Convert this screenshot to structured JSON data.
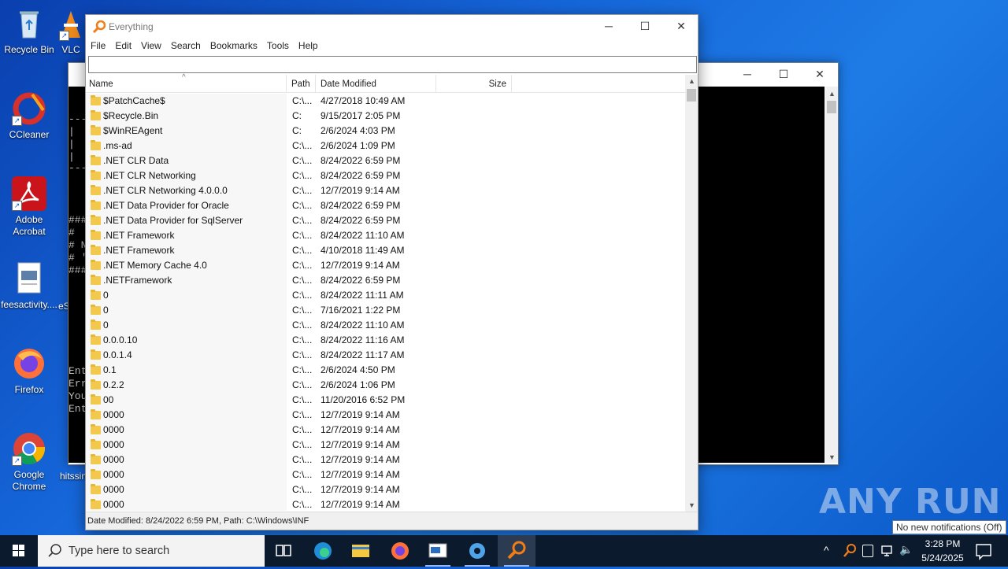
{
  "desktop_icons": [
    {
      "label": "Recycle Bin",
      "icon": "recycle-bin-icon"
    },
    {
      "label": "VLC",
      "icon": "vlc-icon"
    },
    {
      "label": "CCleaner",
      "icon": "ccleaner-icon"
    },
    {
      "label": "Adobe Acrobat",
      "icon": "acrobat-icon"
    },
    {
      "label": "feesactivity....",
      "icon": "image-file-icon"
    },
    {
      "label": "Firefox",
      "icon": "firefox-icon"
    },
    {
      "label": "Google Chrome",
      "icon": "chrome-icon"
    },
    {
      "label": "eSel",
      "icon": "partial-icon"
    },
    {
      "label": "hitssin",
      "icon": "partial-icon"
    }
  ],
  "console_window": {
    "lines": [
      "---",
      "|",
      "|",
      "|",
      "---",
      "###",
      "#",
      "# N",
      "# '",
      "###",
      "Ent",
      "Err",
      "You",
      "Ent"
    ]
  },
  "everything": {
    "title": "Everything",
    "menu": [
      "File",
      "Edit",
      "View",
      "Search",
      "Bookmarks",
      "Tools",
      "Help"
    ],
    "search_value": "",
    "columns": {
      "name": "Name",
      "path": "Path",
      "date": "Date Modified",
      "size": "Size"
    },
    "rows": [
      {
        "name": "$PatchCache$",
        "path": "C:\\...",
        "date": "4/27/2018 10:49 AM"
      },
      {
        "name": "$Recycle.Bin",
        "path": "C:",
        "date": "9/15/2017 2:05 PM"
      },
      {
        "name": "$WinREAgent",
        "path": "C:",
        "date": "2/6/2024 4:03 PM"
      },
      {
        "name": ".ms-ad",
        "path": "C:\\...",
        "date": "2/6/2024 1:09 PM"
      },
      {
        "name": ".NET CLR Data",
        "path": "C:\\...",
        "date": "8/24/2022 6:59 PM"
      },
      {
        "name": ".NET CLR Networking",
        "path": "C:\\...",
        "date": "8/24/2022 6:59 PM"
      },
      {
        "name": ".NET CLR Networking 4.0.0.0",
        "path": "C:\\...",
        "date": "12/7/2019 9:14 AM"
      },
      {
        "name": ".NET Data Provider for Oracle",
        "path": "C:\\...",
        "date": "8/24/2022 6:59 PM"
      },
      {
        "name": ".NET Data Provider for SqlServer",
        "path": "C:\\...",
        "date": "8/24/2022 6:59 PM"
      },
      {
        "name": ".NET Framework",
        "path": "C:\\...",
        "date": "8/24/2022 11:10 AM"
      },
      {
        "name": ".NET Framework",
        "path": "C:\\...",
        "date": "4/10/2018 11:49 AM"
      },
      {
        "name": ".NET Memory Cache 4.0",
        "path": "C:\\...",
        "date": "12/7/2019 9:14 AM"
      },
      {
        "name": ".NETFramework",
        "path": "C:\\...",
        "date": "8/24/2022 6:59 PM"
      },
      {
        "name": "0",
        "path": "C:\\...",
        "date": "8/24/2022 11:11 AM"
      },
      {
        "name": "0",
        "path": "C:\\...",
        "date": "7/16/2021 1:22 PM"
      },
      {
        "name": "0",
        "path": "C:\\...",
        "date": "8/24/2022 11:10 AM"
      },
      {
        "name": "0.0.0.10",
        "path": "C:\\...",
        "date": "8/24/2022 11:16 AM"
      },
      {
        "name": "0.0.1.4",
        "path": "C:\\...",
        "date": "8/24/2022 11:17 AM"
      },
      {
        "name": "0.1",
        "path": "C:\\...",
        "date": "2/6/2024 4:50 PM"
      },
      {
        "name": "0.2.2",
        "path": "C:\\...",
        "date": "2/6/2024 1:06 PM"
      },
      {
        "name": "00",
        "path": "C:\\...",
        "date": "11/20/2016 6:52 PM"
      },
      {
        "name": "0000",
        "path": "C:\\...",
        "date": "12/7/2019 9:14 AM"
      },
      {
        "name": "0000",
        "path": "C:\\...",
        "date": "12/7/2019 9:14 AM"
      },
      {
        "name": "0000",
        "path": "C:\\...",
        "date": "12/7/2019 9:14 AM"
      },
      {
        "name": "0000",
        "path": "C:\\...",
        "date": "12/7/2019 9:14 AM"
      },
      {
        "name": "0000",
        "path": "C:\\...",
        "date": "12/7/2019 9:14 AM"
      },
      {
        "name": "0000",
        "path": "C:\\...",
        "date": "12/7/2019 9:14 AM"
      },
      {
        "name": "0000",
        "path": "C:\\...",
        "date": "12/7/2019 9:14 AM"
      }
    ],
    "status": "Date Modified: 8/24/2022 6:59 PM, Path: C:\\Windows\\INF"
  },
  "taskbar": {
    "search_placeholder": "Type here to search",
    "time": "3:28 PM",
    "date": "5/24/2025",
    "tooltip": "No new notifications (Off)"
  },
  "watermark": "ANY RUN",
  "colors": {
    "desktop": "#1565d8",
    "taskbar": "#0c1a2e",
    "folder": "#f2c94c"
  }
}
